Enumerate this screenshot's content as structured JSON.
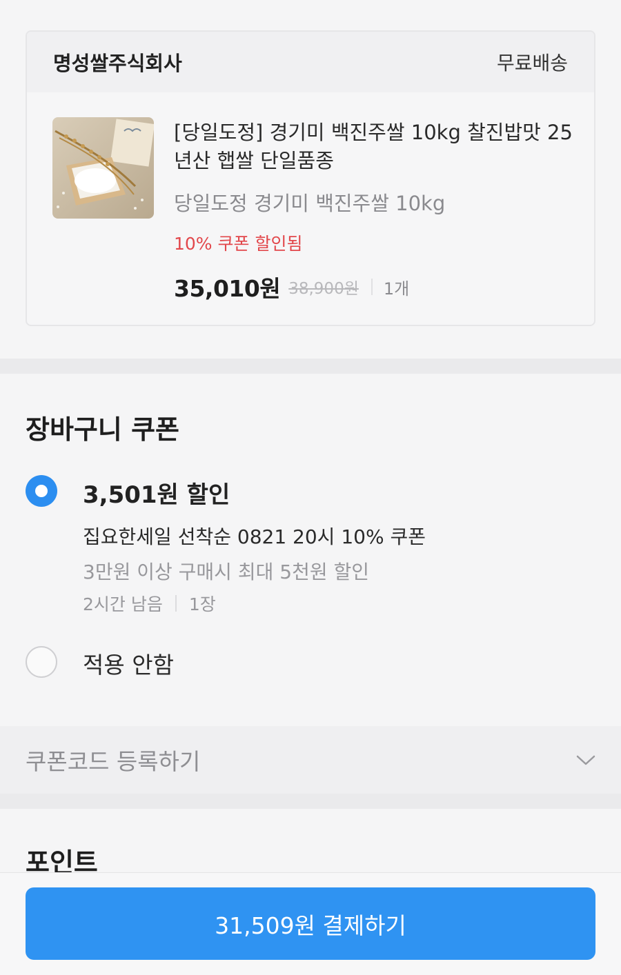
{
  "seller": {
    "name": "명성쌀주식회사",
    "shipping": "무료배송"
  },
  "product": {
    "title": "[당일도정] 경기미 백진주쌀 10kg 찰진밥맛 25년산 햅쌀 단일품종",
    "option": "당일도정 경기미 백진주쌀 10kg",
    "coupon_applied": "10% 쿠폰 할인됨",
    "price": "35,010원",
    "original_price": "38,900원",
    "quantity": "1개"
  },
  "cart_coupon": {
    "title": "장바구니 쿠폰",
    "selected": {
      "discount": "3,501원 할인",
      "name": "집요한세일 선착순 0821 20시 10% 쿠폰",
      "condition": "3만원 이상 구매시 최대 5천원 할인",
      "time_left": "2시간 남음",
      "count": "1장"
    },
    "none_label": "적용 안함"
  },
  "coupon_code": {
    "label": "쿠폰코드 등록하기",
    "icon": "chevron-down-icon"
  },
  "point": {
    "title": "포인트"
  },
  "pay": {
    "label": "31,509원 결제하기"
  },
  "colors": {
    "accent": "#2f93f2",
    "discount_red": "#e2474b"
  }
}
